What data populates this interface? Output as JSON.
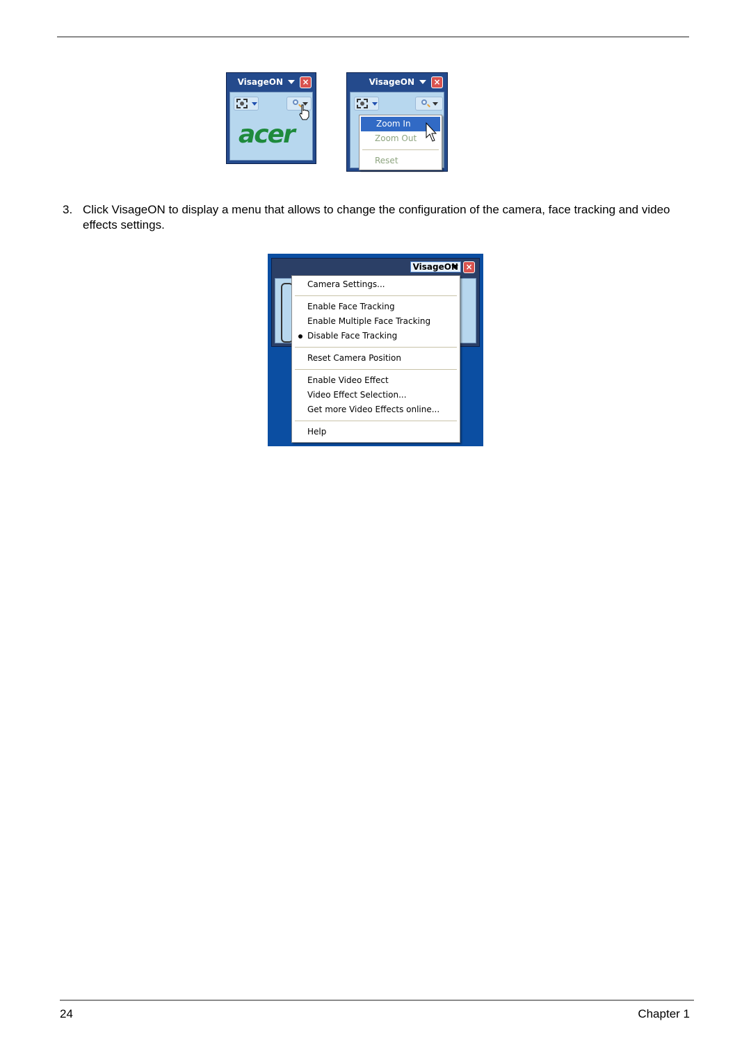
{
  "widget1": {
    "title": "VisageON",
    "logo": "acer",
    "close_glyph": "×",
    "icons": [
      "camera-frame-icon",
      "zoom-magnifier-icon",
      "hand-cursor-icon"
    ]
  },
  "widget2": {
    "title": "VisageON",
    "close_glyph": "×",
    "zoom_menu": {
      "items": [
        {
          "label": "Zoom In",
          "state": "highlighted"
        },
        {
          "label": "Zoom Out",
          "state": "disabled"
        },
        {
          "label": "Reset",
          "state": "disabled"
        }
      ]
    }
  },
  "step": {
    "number": "3.",
    "text": "Click VisageON to display a menu that allows to change the configuration of the camera, face tracking and video effects settings."
  },
  "widget3": {
    "title": "VisageON",
    "close_glyph": "×",
    "menu": {
      "items": [
        {
          "label": "Camera Settings..."
        },
        {
          "label": "Enable Face Tracking"
        },
        {
          "label": "Enable Multiple Face Tracking"
        },
        {
          "label": "Disable Face Tracking",
          "checked": true
        },
        {
          "label": "Reset Camera Position"
        },
        {
          "label": "Enable Video Effect"
        },
        {
          "label": "Video Effect Selection..."
        },
        {
          "label": "Get more Video Effects online..."
        },
        {
          "label": "Help"
        }
      ]
    }
  },
  "footer": {
    "page_number": "24",
    "chapter": "Chapter 1"
  },
  "colors": {
    "window_blue": "#244a8c",
    "panel_blue": "#b7d7ee",
    "highlight": "#316ac5",
    "close_red": "#d9534f",
    "acer_green": "#1e8a3c"
  }
}
